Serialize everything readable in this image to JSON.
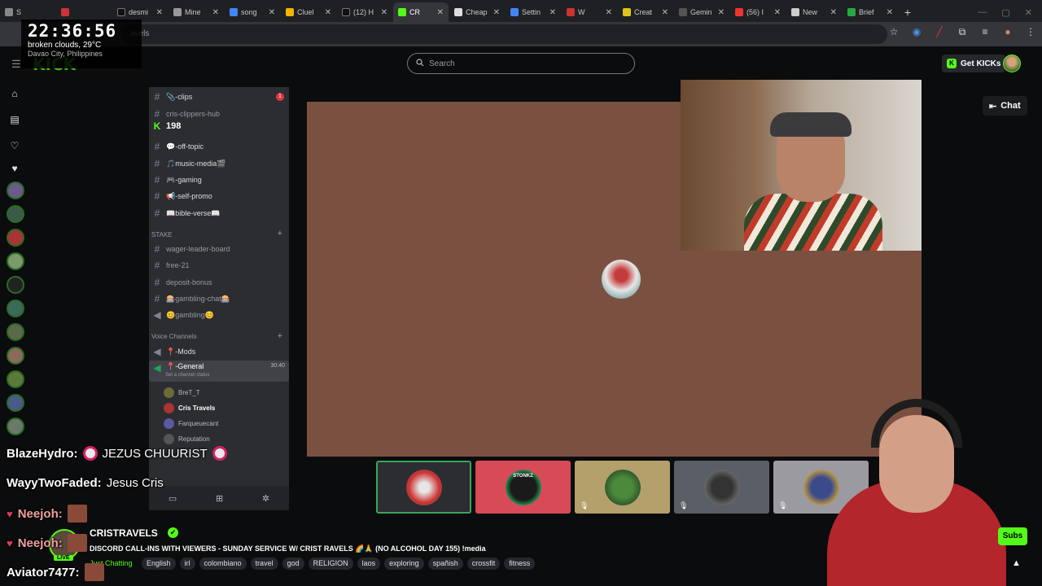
{
  "browser": {
    "tabs": [
      {
        "label": "S",
        "fav": "#888"
      },
      {
        "label": "",
        "fav": "#c33"
      },
      {
        "label": "desmi",
        "fav": "#111"
      },
      {
        "label": "Mine",
        "fav": "#999"
      },
      {
        "label": "song",
        "fav": "#4285f4"
      },
      {
        "label": "Cluel",
        "fav": "#f4b400"
      },
      {
        "label": "(12) H",
        "fav": "#111"
      },
      {
        "label": "CR",
        "fav": "#53fc18"
      },
      {
        "label": "Cheap",
        "fav": "#ddd"
      },
      {
        "label": "Settin",
        "fav": "#4285f4"
      },
      {
        "label": "W",
        "fav": "#c33"
      },
      {
        "label": "Creat",
        "fav": "#e2c31a"
      },
      {
        "label": "Gemin",
        "fav": "#555"
      },
      {
        "label": "(56) I",
        "fav": "#e33"
      },
      {
        "label": "New",
        "fav": "#ccc"
      },
      {
        "label": "Brief",
        "fav": "#27a844"
      }
    ],
    "active_tab_index": 7,
    "new_tab": "+",
    "url_partial": "avels"
  },
  "clock": {
    "time": "22:36:56",
    "weather": "broken clouds, 29°C",
    "city": "Davao City, Philippines"
  },
  "kick": {
    "logo": "KICK",
    "search_placeholder": "Search",
    "get_kicks": "Get KICKs",
    "chat_button": "Chat",
    "subs_button": "Subs"
  },
  "discord": {
    "channels": [
      {
        "name": "📎-clips",
        "badge": "1"
      },
      {
        "name": "cris-clippers-hub"
      },
      {
        "name": "198"
      },
      {
        "name": "💬-off-topic"
      },
      {
        "name": "🎵music-media🎬"
      },
      {
        "name": "🎮-gaming"
      },
      {
        "name": "📢-self-promo"
      },
      {
        "name": "📖bible-verse📖"
      }
    ],
    "stake_category": "STAKE",
    "stake_channels": [
      {
        "name": "wager-leader-board"
      },
      {
        "name": "free-21"
      },
      {
        "name": "deposit-bonus"
      },
      {
        "name": "🎰gambling-chat🎰"
      },
      {
        "name": "😊gambling😊"
      }
    ],
    "voice_category": "Voice Channels",
    "voice_channels": [
      {
        "name": "📍-Mods"
      },
      {
        "name": "📍-General",
        "time": "30:40",
        "status": "Set a channel status"
      }
    ],
    "voice_users": [
      "BreT_T",
      "Cris Travels",
      "Farqueuecant",
      "Reputation"
    ]
  },
  "tiles": [
    {
      "bg": "#2b2d31",
      "border": "#3ba55c"
    },
    {
      "bg": "#d84a57",
      "label": "STONKZ"
    },
    {
      "bg": "#b3a06a"
    },
    {
      "bg": "#5a5e66"
    },
    {
      "bg": "#9a9aa0"
    }
  ],
  "stream": {
    "streamer": "CRISTRAVELS",
    "live": "LIVE",
    "title": "DISCORD CALL-INS WITH VIEWERS - SUNDAY SERVICE W/ CRIST RAVELS 🌈🙏 (NO ALCOHOL DAY 155) !media",
    "category": "Just Chatting",
    "tags": [
      "English",
      "irl",
      "colombiano",
      "travel",
      "god",
      "RELIGION",
      "laos",
      "exploring",
      "spañish",
      "crossfit",
      "fitness"
    ]
  },
  "overlay_chat": [
    {
      "user": "BlazeHydro:",
      "msg": "JEZUS CHUURIST"
    },
    {
      "user": "WayyTwoFaded:",
      "msg": "Jesus Cris"
    },
    {
      "user": "Neejoh:",
      "msg": ""
    },
    {
      "user": "Neejoh:",
      "msg": ""
    },
    {
      "user": "Aviator7477:",
      "msg": ""
    }
  ],
  "colors": {
    "kick_green": "#53fc18",
    "discord_bg": "#2b2d31",
    "stage_bg": "#7a5140"
  }
}
